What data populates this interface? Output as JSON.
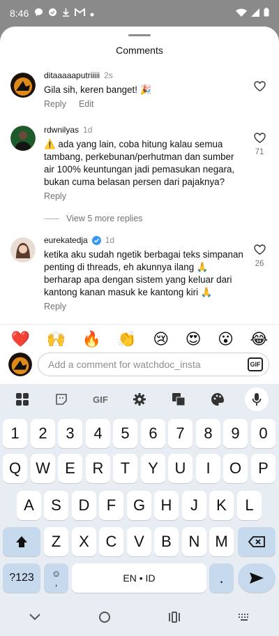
{
  "status_bar": {
    "time": "8:46"
  },
  "sheet": {
    "title": "Comments"
  },
  "comments": [
    {
      "username": "ditaaaaaputriiiii",
      "time": "2s",
      "text": "Gila sih, keren banget! 🎉",
      "reply": "Reply",
      "edit": "Edit",
      "likes": ""
    },
    {
      "username": "rdwnilyas",
      "time": "1d",
      "text": "⚠️ ada yang lain, coba hitung kalau semua tambang, perkebunan/perhutman dan sumber air 100% keuntungan jadi pemasukan negara, bukan cuma belasan persen dari pajaknya?",
      "reply": "Reply",
      "likes": "71",
      "view_more": "View 5 more replies"
    },
    {
      "username": "eurekatedja",
      "time": "1d",
      "text": "ketika aku sudah ngetik berbagai teks simpanan penting di threads, eh akunnya ilang 🙏\nberharap apa dengan sistem yang keluar dari kantong kanan masuk ke kantong kiri 🙏",
      "reply": "Reply",
      "likes": "26"
    }
  ],
  "emoji_bar": [
    "❤️",
    "🙌",
    "🔥",
    "👏",
    "😢",
    "😍",
    "😮",
    "😂"
  ],
  "input": {
    "placeholder": "Add a comment for watchdoc_insta",
    "gif": "GIF"
  },
  "keyboard": {
    "toolbar": {
      "gif": "GIF"
    },
    "row_numbers": [
      "1",
      "2",
      "3",
      "4",
      "5",
      "6",
      "7",
      "8",
      "9",
      "0"
    ],
    "row1": [
      "Q",
      "W",
      "E",
      "R",
      "T",
      "Y",
      "U",
      "I",
      "O",
      "P"
    ],
    "row2": [
      "A",
      "S",
      "D",
      "F",
      "G",
      "H",
      "J",
      "K",
      "L"
    ],
    "row3": [
      "Z",
      "X",
      "C",
      "V",
      "B",
      "N",
      "M"
    ],
    "symbols": "?123",
    "emoji_comma": "☺\n,",
    "space": "EN • ID",
    "period": "."
  }
}
